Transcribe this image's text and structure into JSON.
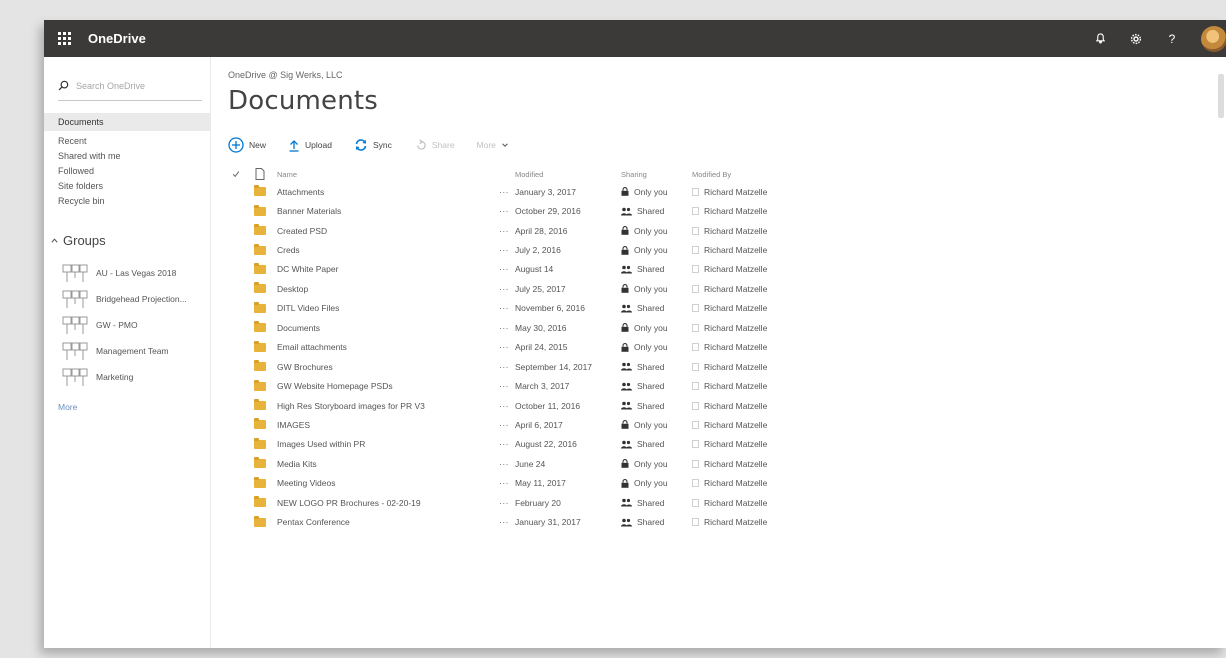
{
  "suite": {
    "brand": "OneDrive",
    "icons": [
      "bell-icon",
      "gear-icon",
      "help-icon",
      "avatar"
    ],
    "help_glyph": "?",
    "colors": {
      "suitebar": "#3b3a39",
      "accent": "#0078d4",
      "folder": "#e8b33a"
    }
  },
  "leftnav": {
    "search_placeholder": "Search OneDrive",
    "items": [
      {
        "label": "Documents",
        "selected": true
      },
      {
        "label": "Recent"
      },
      {
        "label": "Shared with me"
      },
      {
        "label": "Followed"
      },
      {
        "label": "Site folders"
      },
      {
        "label": "Recycle bin"
      }
    ],
    "groups_title": "Groups",
    "groups": [
      {
        "label": "AU - Las Vegas 2018"
      },
      {
        "label": "Bridgehead Projection..."
      },
      {
        "label": "GW - PMO"
      },
      {
        "label": "Management Team"
      },
      {
        "label": "Marketing"
      }
    ],
    "more": "More"
  },
  "main": {
    "breadcrumb": "OneDrive @ Sig Werks, LLC",
    "title": "Documents",
    "commands": {
      "new": "New",
      "upload": "Upload",
      "sync": "Sync",
      "share": "Share",
      "more": "More"
    },
    "columns": {
      "name": "Name",
      "modified": "Modified",
      "sharing": "Sharing",
      "modified_by": "Modified By"
    },
    "rows": [
      {
        "name": "Attachments",
        "modified": "January 3, 2017",
        "sharing": "Only you",
        "modified_by": "Richard Matzelle",
        "shared": false
      },
      {
        "name": "Banner Materials",
        "modified": "October 29, 2016",
        "sharing": "Shared",
        "modified_by": "Richard Matzelle",
        "shared": true
      },
      {
        "name": "Created PSD",
        "modified": "April 28, 2016",
        "sharing": "Only you",
        "modified_by": "Richard Matzelle",
        "shared": false
      },
      {
        "name": "Creds",
        "modified": "July 2, 2016",
        "sharing": "Only you",
        "modified_by": "Richard Matzelle",
        "shared": false
      },
      {
        "name": "DC White Paper",
        "modified": "August 14",
        "sharing": "Shared",
        "modified_by": "Richard Matzelle",
        "shared": true
      },
      {
        "name": "Desktop",
        "modified": "July 25, 2017",
        "sharing": "Only you",
        "modified_by": "Richard Matzelle",
        "shared": false
      },
      {
        "name": "DITL Video Files",
        "modified": "November 6, 2016",
        "sharing": "Shared",
        "modified_by": "Richard Matzelle",
        "shared": true
      },
      {
        "name": "Documents",
        "modified": "May 30, 2016",
        "sharing": "Only you",
        "modified_by": "Richard Matzelle",
        "shared": false
      },
      {
        "name": "Email attachments",
        "modified": "April 24, 2015",
        "sharing": "Only you",
        "modified_by": "Richard Matzelle",
        "shared": false
      },
      {
        "name": "GW Brochures",
        "modified": "September 14, 2017",
        "sharing": "Shared",
        "modified_by": "Richard Matzelle",
        "shared": true
      },
      {
        "name": "GW Website Homepage PSDs",
        "modified": "March 3, 2017",
        "sharing": "Shared",
        "modified_by": "Richard Matzelle",
        "shared": true
      },
      {
        "name": "High Res Storyboard images for PR V3",
        "modified": "October 11, 2016",
        "sharing": "Shared",
        "modified_by": "Richard Matzelle",
        "shared": true
      },
      {
        "name": "IMAGES",
        "modified": "April 6, 2017",
        "sharing": "Only you",
        "modified_by": "Richard Matzelle",
        "shared": false
      },
      {
        "name": "Images Used within PR",
        "modified": "August 22, 2016",
        "sharing": "Shared",
        "modified_by": "Richard Matzelle",
        "shared": true
      },
      {
        "name": "Media Kits",
        "modified": "June 24",
        "sharing": "Only you",
        "modified_by": "Richard Matzelle",
        "shared": false
      },
      {
        "name": "Meeting Videos",
        "modified": "May 11, 2017",
        "sharing": "Only you",
        "modified_by": "Richard Matzelle",
        "shared": false
      },
      {
        "name": "NEW LOGO PR Brochures - 02-20-19",
        "modified": "February 20",
        "sharing": "Shared",
        "modified_by": "Richard Matzelle",
        "shared": true
      },
      {
        "name": "Pentax Conference",
        "modified": "January 31, 2017",
        "sharing": "Shared",
        "modified_by": "Richard Matzelle",
        "shared": true
      }
    ]
  }
}
